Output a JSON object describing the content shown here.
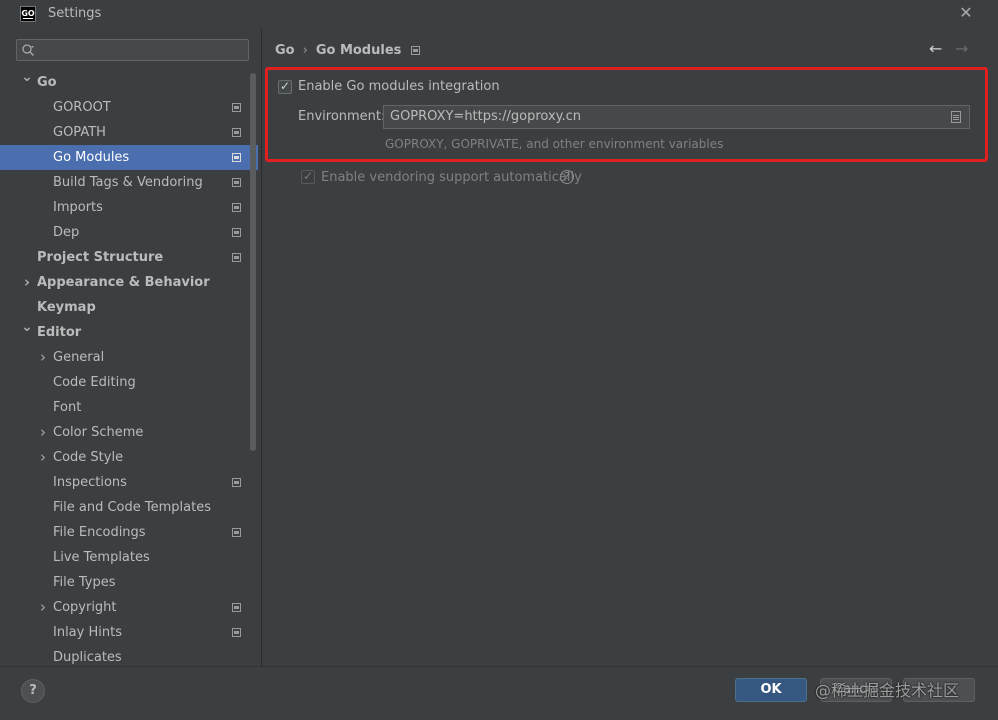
{
  "window": {
    "title": "Settings",
    "app_icon_text": "GO"
  },
  "search": {
    "placeholder": ""
  },
  "tree": [
    {
      "label": "Go",
      "level": 0,
      "expanded": true,
      "bold": true,
      "chevron": "down",
      "project_icon": false
    },
    {
      "label": "GOROOT",
      "level": 1,
      "project_icon": true
    },
    {
      "label": "GOPATH",
      "level": 1,
      "project_icon": true
    },
    {
      "label": "Go Modules",
      "level": 1,
      "project_icon": true,
      "selected": true
    },
    {
      "label": "Build Tags & Vendoring",
      "level": 1,
      "project_icon": true
    },
    {
      "label": "Imports",
      "level": 1,
      "project_icon": true
    },
    {
      "label": "Dep",
      "level": 1,
      "project_icon": true
    },
    {
      "label": "Project Structure",
      "level": 0,
      "bold": true,
      "project_icon": true
    },
    {
      "label": "Appearance & Behavior",
      "level": 0,
      "bold": true,
      "chevron": "right"
    },
    {
      "label": "Keymap",
      "level": 0,
      "bold": true
    },
    {
      "label": "Editor",
      "level": 0,
      "bold": true,
      "chevron": "down"
    },
    {
      "label": "General",
      "level": 1,
      "chevron": "right"
    },
    {
      "label": "Code Editing",
      "level": 1
    },
    {
      "label": "Font",
      "level": 1
    },
    {
      "label": "Color Scheme",
      "level": 1,
      "chevron": "right"
    },
    {
      "label": "Code Style",
      "level": 1,
      "chevron": "right"
    },
    {
      "label": "Inspections",
      "level": 1,
      "project_icon": true
    },
    {
      "label": "File and Code Templates",
      "level": 1
    },
    {
      "label": "File Encodings",
      "level": 1,
      "project_icon": true
    },
    {
      "label": "Live Templates",
      "level": 1
    },
    {
      "label": "File Types",
      "level": 1
    },
    {
      "label": "Copyright",
      "level": 1,
      "chevron": "right",
      "project_icon": true
    },
    {
      "label": "Inlay Hints",
      "level": 1,
      "project_icon": true
    },
    {
      "label": "Duplicates",
      "level": 1
    }
  ],
  "breadcrumb": {
    "parent": "Go",
    "separator": "›",
    "current": "Go Modules"
  },
  "nav": {
    "back_icon": "arrow-left-icon",
    "forward_icon": "arrow-right-icon"
  },
  "settings": {
    "enable_modules": {
      "label": "Enable Go modules integration",
      "checked": true
    },
    "environment": {
      "label": "Environment:",
      "value": "GOPROXY=https://goproxy.cn",
      "hint": "GOPROXY, GOPRIVATE, and other environment variables"
    },
    "vendoring": {
      "label": "Enable vendoring support automatically",
      "checked": true,
      "disabled": true
    }
  },
  "footer": {
    "help_label": "?",
    "ok_label": "OK",
    "cancel_label": "Cancel",
    "apply_label": "",
    "watermark": "@稀土掘金技术社区"
  },
  "colors": {
    "background": "#3c3f41",
    "selection": "#4b6eaf",
    "ok_button": "#365880",
    "highlight_border": "#e02020"
  }
}
